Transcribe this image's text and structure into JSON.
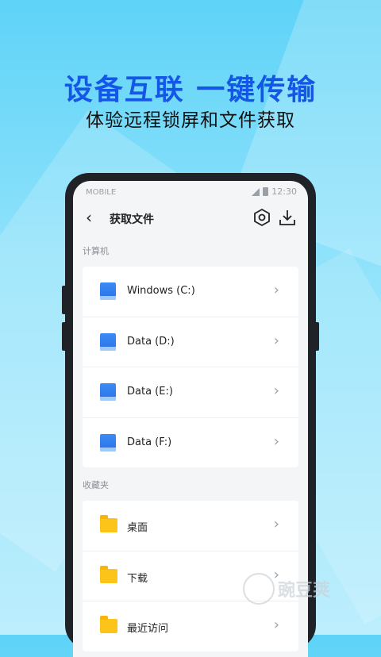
{
  "promo": {
    "headline": "设备互联 一键传输",
    "subline": "体验远程锁屏和文件获取"
  },
  "statusbar": {
    "carrier": "MOBILE",
    "time": "12:30"
  },
  "navbar": {
    "back_icon": "chevron-left-icon",
    "title": "获取文件",
    "settings_icon": "hexagon-settings-icon",
    "download_icon": "download-icon"
  },
  "sections": {
    "computer": {
      "label": "计算机",
      "items": [
        {
          "label": "Windows (C:)",
          "icon": "drive-icon"
        },
        {
          "label": "Data (D:)",
          "icon": "drive-icon"
        },
        {
          "label": "Data (E:)",
          "icon": "drive-icon"
        },
        {
          "label": "Data (F:)",
          "icon": "drive-icon"
        }
      ]
    },
    "favorites": {
      "label": "收藏夹",
      "items": [
        {
          "label": "桌面",
          "icon": "folder-icon"
        },
        {
          "label": "下载",
          "icon": "folder-icon"
        },
        {
          "label": "最近访问",
          "icon": "folder-icon"
        }
      ]
    }
  },
  "watermark": {
    "text": "豌豆荚"
  },
  "colors": {
    "accent": "#1456e6",
    "drive": "#2970e8",
    "folder": "#fcc419"
  }
}
